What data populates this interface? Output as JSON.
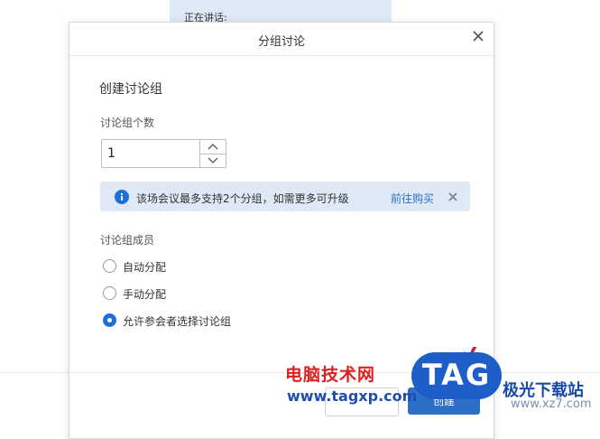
{
  "background": {
    "speaking_label": "正在讲话:"
  },
  "dialog": {
    "title": "分组讨论",
    "section_title": "创建讨论组",
    "group_count": {
      "label": "讨论组个数",
      "value": "1"
    },
    "notice": {
      "message": "该场会议最多支持2个分组，如需更多可升级",
      "link": "前往购买"
    },
    "members": {
      "label": "讨论组成员",
      "options": [
        {
          "label": "自动分配",
          "selected": false
        },
        {
          "label": "手动分配",
          "selected": false
        },
        {
          "label": "允许参会者选择讨论组",
          "selected": true
        }
      ]
    },
    "footer": {
      "create_label": "创建"
    }
  },
  "watermark": {
    "cn": "电脑技术网",
    "url": "www.tagxp.com",
    "tag": "TAG",
    "site": "极光下载站",
    "url2": "www.xz7.com"
  },
  "colors": {
    "accent": "#1e6fd9",
    "notice_bg": "#dfe9f6",
    "link": "#2b6fc7",
    "watermark_red": "#e02020"
  }
}
